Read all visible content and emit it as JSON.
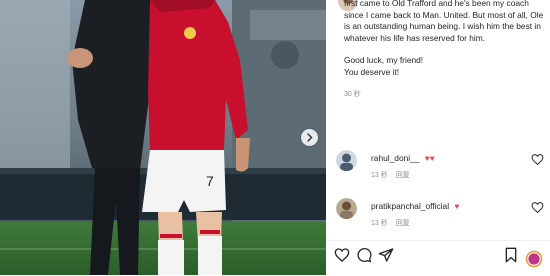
{
  "post": {
    "caption_lines": [
      "first came to Old Trafford and he's been my coach since I came back to Man. United. But most of all, Ole is an outstanding human being. I wish him the best in whatever his life has reserved for him.",
      "Good luck, my friend!",
      "You deserve it!"
    ],
    "caption_time": "30 秒",
    "jersey_number": "7"
  },
  "comments": [
    {
      "username": "rahul_doni__",
      "emoji": "♥♥",
      "time": "13 秒",
      "reply": "回复"
    },
    {
      "username": "pratikpanchal_official",
      "emoji": "♥",
      "time": "13 秒",
      "reply": "回复"
    }
  ],
  "icons": {
    "heart": "heart-icon",
    "comment": "comment-icon",
    "share": "share-icon",
    "bookmark": "bookmark-icon",
    "next": "chevron-right-icon"
  },
  "colors": {
    "heart_red": "#ed4956",
    "jersey_red": "#c8102e",
    "muted": "#8e8e8e"
  }
}
